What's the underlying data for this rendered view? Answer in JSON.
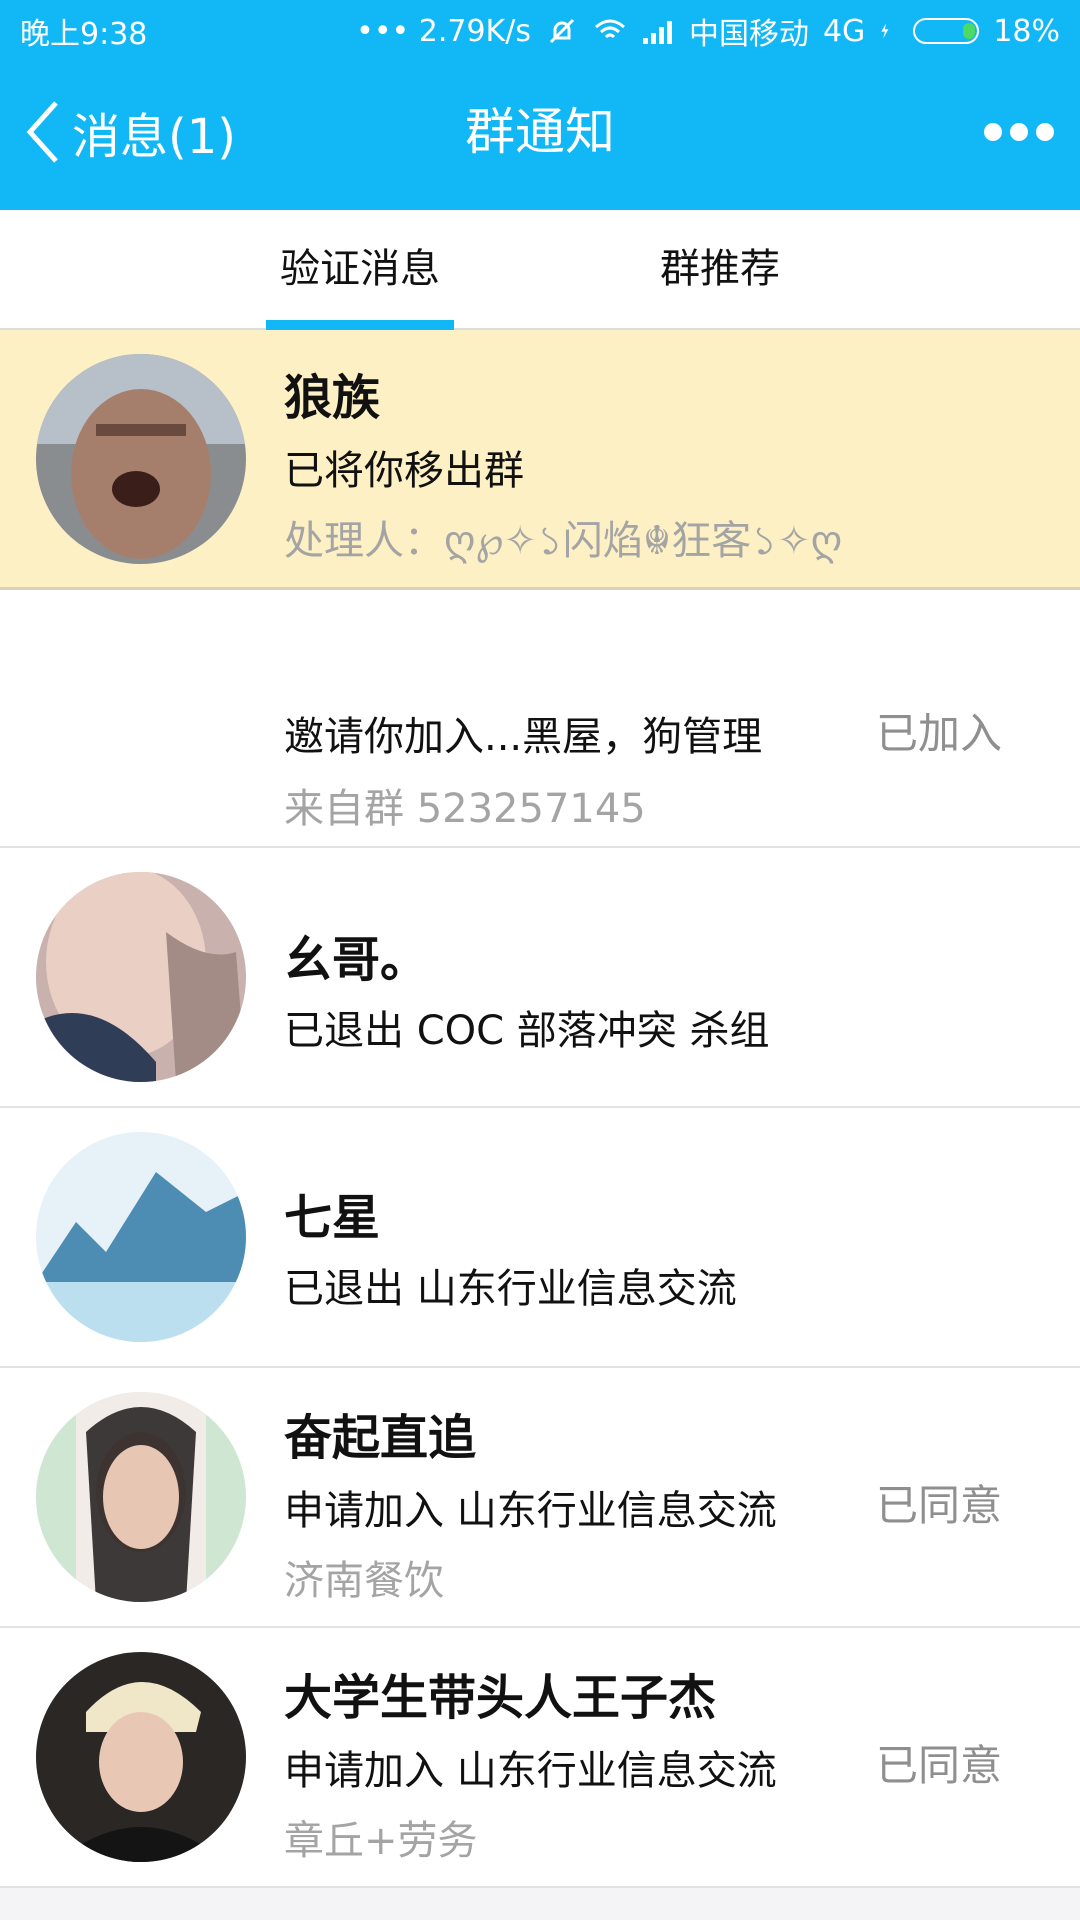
{
  "status_bar": {
    "time": "晚上9:38",
    "speed": "••• 2.79K/s",
    "carrier": "中国移动",
    "network": "4G",
    "battery": "18%",
    "battery_level": 0.18
  },
  "header": {
    "back_label": "消息(1)",
    "title": "群通知",
    "back_icon": "chevron-left-icon",
    "more_icon": "more-dots-icon"
  },
  "tabs": [
    {
      "label": "验证消息",
      "active": true
    },
    {
      "label": "群推荐",
      "active": false
    }
  ],
  "notifications": [
    {
      "name": "狼族",
      "message": "已将你移出群",
      "detail": "处理人：ღ℘✧১闪焰☬狂客১✧ღ",
      "status": ""
    },
    {
      "name": "",
      "message": "邀请你加入...黑屋，狗管理",
      "detail": "来自群 523257145",
      "status": "已加入"
    },
    {
      "name": "幺哥。",
      "message": "已退出 COC 部落冲突   杀组",
      "detail": "",
      "status": ""
    },
    {
      "name": "七星",
      "message": "已退出 山东行业信息交流",
      "detail": "",
      "status": ""
    },
    {
      "name": "奋起直追",
      "message": "申请加入 山东行业信息交流",
      "detail": "济南餐饮",
      "status": "已同意"
    },
    {
      "name": "大学生带头人王子杰",
      "message": "申请加入 山东行业信息交流",
      "detail": "章丘+劳务",
      "status": "已同意"
    }
  ],
  "colors": {
    "accent": "#12b7f5",
    "highlight_row": "#fcf0c4",
    "secondary_text": "#a4a4a4"
  }
}
